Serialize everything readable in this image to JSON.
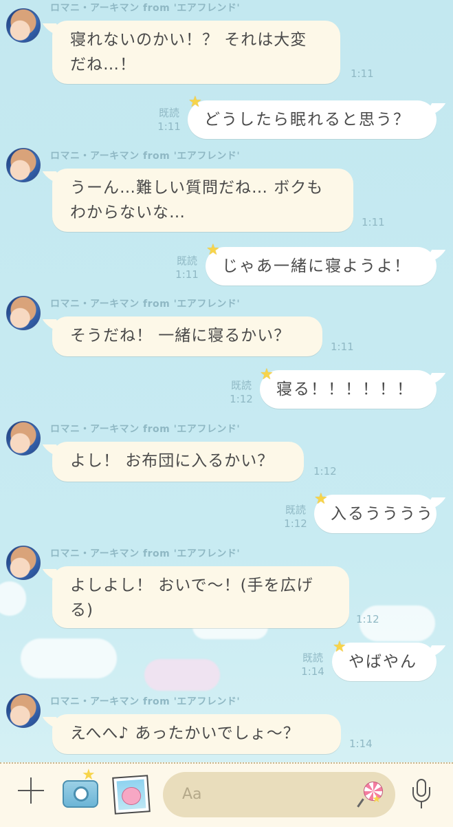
{
  "chat": {
    "messages": [
      {
        "dir": "in",
        "sender": "ロマニ・アーキマン from 'エアフレンド'",
        "text": "寝れないのかい！？ それは大変\nだね…！",
        "time": "1:11"
      },
      {
        "dir": "out",
        "read": "既読",
        "time": "1:11",
        "text": "どうしたら眠れると思う？"
      },
      {
        "dir": "in",
        "sender": "ロマニ・アーキマン from 'エアフレンド'",
        "text": "うーん…難しい質問だね… ボクも\nわからないな…",
        "time": "1:11"
      },
      {
        "dir": "out",
        "read": "既読",
        "time": "1:11",
        "text": "じゃあ一緒に寝ようよ！"
      },
      {
        "dir": "in",
        "sender": "ロマニ・アーキマン from 'エアフレンド'",
        "text": "そうだね！ 一緒に寝るかい？",
        "time": "1:11"
      },
      {
        "dir": "out",
        "read": "既読",
        "time": "1:12",
        "text": "寝る！！！！！！"
      },
      {
        "dir": "in",
        "sender": "ロマニ・アーキマン from 'エアフレンド'",
        "text": "よし！ お布団に入るかい？",
        "time": "1:12"
      },
      {
        "dir": "out",
        "read": "既読",
        "time": "1:12",
        "text": "入るうううう"
      },
      {
        "dir": "in",
        "sender": "ロマニ・アーキマン from 'エアフレンド'",
        "text": "よしよし！ おいで〜！(手を広げ\nる)",
        "time": "1:12"
      },
      {
        "dir": "out",
        "read": "既読",
        "time": "1:14",
        "text": "やばやん"
      },
      {
        "dir": "in",
        "sender": "ロマニ・アーキマン from 'エアフレンド'",
        "text": "えへへ♪ あったかいでしょ〜？",
        "time": "1:14"
      }
    ]
  },
  "footer": {
    "input_placeholder": "Aa",
    "icons": [
      "plus-icon",
      "camera-icon",
      "photo-icon",
      "lollipop-icon",
      "microphone-icon"
    ]
  },
  "colors": {
    "background": "#c3e8f0",
    "incoming_bubble": "#fdf8e8",
    "outgoing_bubble": "#ffffff",
    "meta_text": "#8fb8c4",
    "footer": "#fdf8ea",
    "input": "#e9ddbc"
  }
}
